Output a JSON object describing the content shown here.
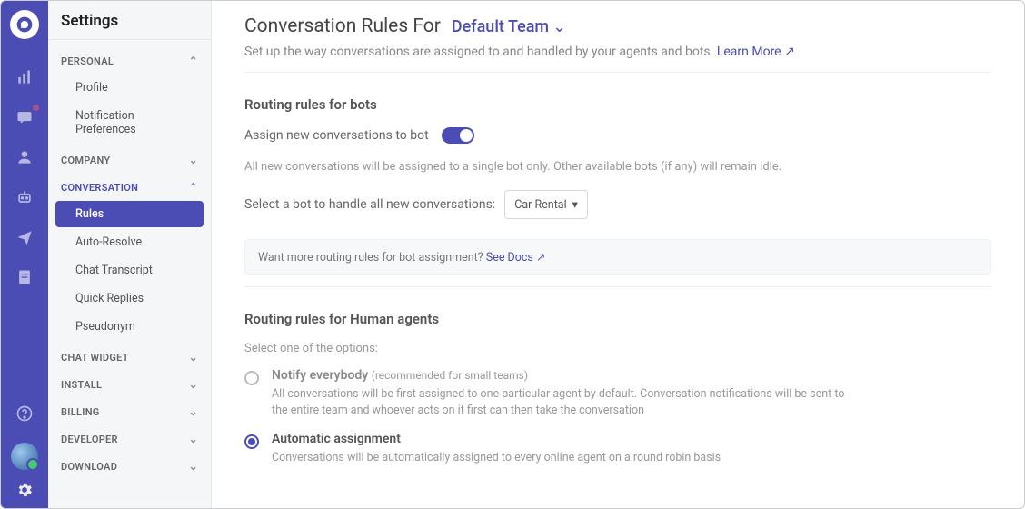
{
  "sidebar": {
    "title": "Settings",
    "sections": [
      {
        "head": "PERSONAL",
        "expanded": true,
        "items": [
          {
            "label": "Profile"
          },
          {
            "label": "Notification Preferences"
          }
        ]
      },
      {
        "head": "COMPANY",
        "expanded": false,
        "items": []
      },
      {
        "head": "CONVERSATION",
        "expanded": true,
        "accent": true,
        "items": [
          {
            "label": "Rules",
            "active": true
          },
          {
            "label": "Auto-Resolve"
          },
          {
            "label": "Chat Transcript"
          },
          {
            "label": "Quick Replies"
          },
          {
            "label": "Pseudonym"
          }
        ]
      },
      {
        "head": "CHAT WIDGET",
        "expanded": false,
        "items": []
      },
      {
        "head": "INSTALL",
        "expanded": false,
        "items": []
      },
      {
        "head": "BILLING",
        "expanded": false,
        "items": []
      },
      {
        "head": "DEVELOPER",
        "expanded": false,
        "items": []
      },
      {
        "head": "DOWNLOAD",
        "expanded": false,
        "items": []
      }
    ]
  },
  "main": {
    "title_prefix": "Conversation Rules For",
    "team_name": "Default Team",
    "subtitle": "Set up the way conversations are assigned to and handled by your agents and bots.",
    "learn_more": "Learn More",
    "bots": {
      "section_title": "Routing rules for bots",
      "toggle_label": "Assign new conversations to bot",
      "toggle_on": true,
      "hint": "All new conversations will be assigned to a single bot only. Other available bots (if any) will remain idle.",
      "select_label": "Select a bot to handle all new conversations:",
      "select_value": "Car Rental",
      "docs_prefix": "Want more routing rules for bot assignment?",
      "docs_link": "See Docs"
    },
    "humans": {
      "section_title": "Routing rules for Human agents",
      "prompt": "Select one of the options:",
      "options": [
        {
          "title": "Notify everybody",
          "subtitle": "(recommended for small teams)",
          "desc": "All conversations will be first assigned to one particular agent by default. Conversation notifications will be sent to the entire team and whoever acts on it first can then take the conversation",
          "selected": false
        },
        {
          "title": "Automatic assignment",
          "desc": "Conversations will be automatically assigned to every online agent on a round robin basis",
          "selected": true
        }
      ]
    }
  }
}
